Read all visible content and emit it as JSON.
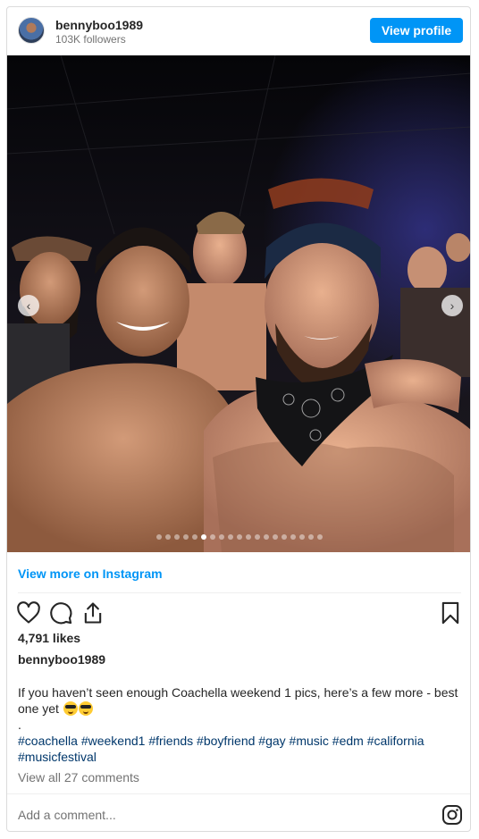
{
  "header": {
    "username": "bennyboo1989",
    "followers": "103K followers",
    "view_profile_label": "View profile"
  },
  "carousel": {
    "dot_count": 19,
    "active_index": 5,
    "prev_glyph": "‹",
    "next_glyph": "›"
  },
  "links": {
    "view_more": "View more on Instagram"
  },
  "stats": {
    "likes": "4,791 likes"
  },
  "post": {
    "caption_user": "bennyboo1989",
    "caption_text": "If you haven’t seen enough Coachella weekend 1 pics, here’s a few more - best one yet",
    "caption_dot": ".",
    "hashtags": "#coachella #weekend1 #friends #boyfriend #gay #music #edm #california #musicfestival",
    "view_comments": "View all 27 comments"
  },
  "comment_box": {
    "placeholder": "Add a comment..."
  },
  "colors": {
    "accent": "#0095f6",
    "hashtag": "#00376b",
    "muted": "#737373"
  },
  "icons": [
    "heart-icon",
    "comment-icon",
    "share-icon",
    "bookmark-icon",
    "instagram-icon",
    "chevron-left-icon",
    "chevron-right-icon"
  ]
}
